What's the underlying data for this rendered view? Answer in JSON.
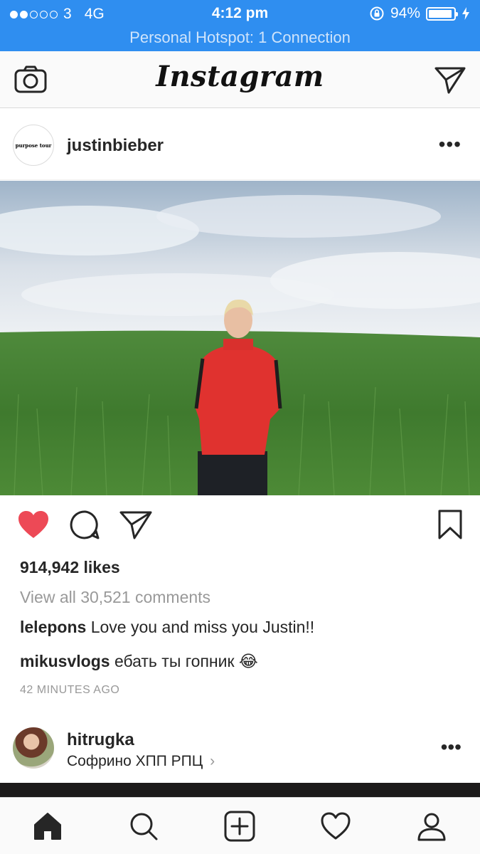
{
  "status_bar": {
    "carrier": "3",
    "network": "4G",
    "time": "4:12 pm",
    "battery": "94%",
    "battery_level": 0.94,
    "hotspot": "Personal Hotspot: 1 Connection"
  },
  "header": {
    "logo": "Instagram",
    "camera_icon": "camera-icon",
    "direct_icon": "paper-plane-icon"
  },
  "post": {
    "avatar_text": "purpose tour",
    "username": "justinbieber",
    "more": "•••",
    "likes": "914,942 likes",
    "view_all": "View all 30,521 comments",
    "comments": [
      {
        "user": "lelepons",
        "text": "Love you and miss you Justin!!"
      },
      {
        "user": "mikusvlogs",
        "text": "ебать ты гопник 😂"
      }
    ],
    "time_ago": "42 MINUTES AGO",
    "liked": true
  },
  "next_post": {
    "username": "hitrugka",
    "location": "Софрино ХПП РПЦ",
    "location_chevron": "›",
    "more": "•••"
  },
  "tabs": [
    {
      "icon": "home-icon",
      "active": true
    },
    {
      "icon": "search-icon"
    },
    {
      "icon": "add-post-icon"
    },
    {
      "icon": "heart-icon"
    },
    {
      "icon": "profile-icon"
    }
  ],
  "colors": {
    "status_bar_bg": "#2f8ef0",
    "like_red": "#ed4956",
    "text": "#262626",
    "muted": "#999999"
  }
}
